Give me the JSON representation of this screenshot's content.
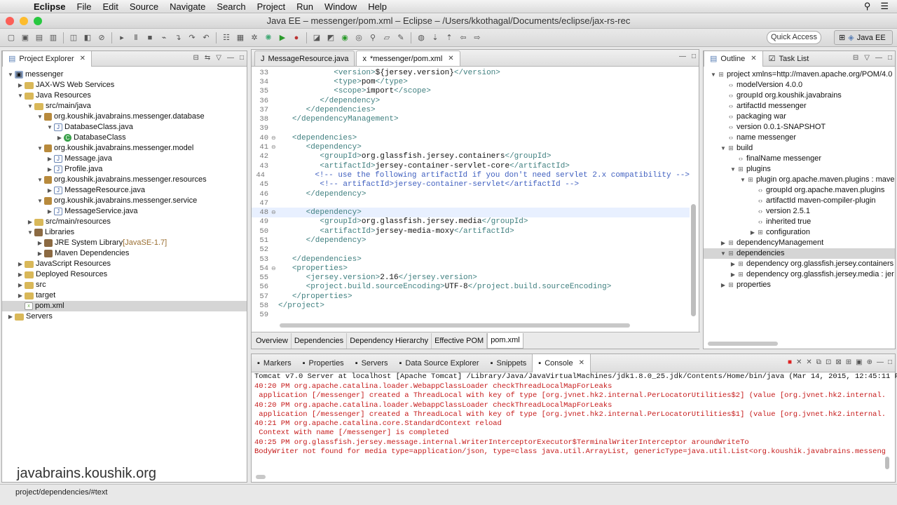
{
  "menubar": {
    "app_name": "Eclipse",
    "items": [
      "File",
      "Edit",
      "Source",
      "Navigate",
      "Search",
      "Project",
      "Run",
      "Window",
      "Help"
    ]
  },
  "window": {
    "title": "Java EE – messenger/pom.xml – Eclipse – /Users/kkothagal/Documents/eclipse/jax-rs-rec"
  },
  "toolbar": {
    "quick_access": "Quick Access",
    "perspective": "Java EE"
  },
  "project_explorer": {
    "tab_label": "Project Explorer",
    "items": [
      {
        "label": "messenger",
        "extra": "",
        "indent": 0,
        "twisty": "open",
        "icon": "proj"
      },
      {
        "label": "JAX-WS Web Services",
        "extra": "",
        "indent": 1,
        "twisty": "closed",
        "icon": "folder"
      },
      {
        "label": "Java Resources",
        "extra": "",
        "indent": 1,
        "twisty": "open",
        "icon": "folder"
      },
      {
        "label": "src/main/java",
        "extra": "",
        "indent": 2,
        "twisty": "open",
        "icon": "folder"
      },
      {
        "label": "org.koushik.javabrains.messenger.database",
        "extra": "",
        "indent": 3,
        "twisty": "open",
        "icon": "pkg"
      },
      {
        "label": "DatabaseClass.java",
        "extra": "",
        "indent": 4,
        "twisty": "open",
        "icon": "java"
      },
      {
        "label": "DatabaseClass",
        "extra": "",
        "indent": 5,
        "twisty": "closed",
        "icon": "cls"
      },
      {
        "label": "org.koushik.javabrains.messenger.model",
        "extra": "",
        "indent": 3,
        "twisty": "open",
        "icon": "pkg"
      },
      {
        "label": "Message.java",
        "extra": "",
        "indent": 4,
        "twisty": "closed",
        "icon": "java"
      },
      {
        "label": "Profile.java",
        "extra": "",
        "indent": 4,
        "twisty": "closed",
        "icon": "java"
      },
      {
        "label": "org.koushik.javabrains.messenger.resources",
        "extra": "",
        "indent": 3,
        "twisty": "open",
        "icon": "pkg"
      },
      {
        "label": "MessageResource.java",
        "extra": "",
        "indent": 4,
        "twisty": "closed",
        "icon": "java"
      },
      {
        "label": "org.koushik.javabrains.messenger.service",
        "extra": "",
        "indent": 3,
        "twisty": "open",
        "icon": "pkg"
      },
      {
        "label": "MessageService.java",
        "extra": "",
        "indent": 4,
        "twisty": "closed",
        "icon": "java"
      },
      {
        "label": "src/main/resources",
        "extra": "",
        "indent": 2,
        "twisty": "closed",
        "icon": "folder"
      },
      {
        "label": "Libraries",
        "extra": "",
        "indent": 2,
        "twisty": "open",
        "icon": "lib"
      },
      {
        "label": "JRE System Library",
        "extra": "[JavaSE-1.7]",
        "indent": 3,
        "twisty": "closed",
        "icon": "lib"
      },
      {
        "label": "Maven Dependencies",
        "extra": "",
        "indent": 3,
        "twisty": "closed",
        "icon": "lib"
      },
      {
        "label": "JavaScript Resources",
        "extra": "",
        "indent": 1,
        "twisty": "closed",
        "icon": "folder"
      },
      {
        "label": "Deployed Resources",
        "extra": "",
        "indent": 1,
        "twisty": "closed",
        "icon": "folder"
      },
      {
        "label": "src",
        "extra": "",
        "indent": 1,
        "twisty": "closed",
        "icon": "folder"
      },
      {
        "label": "target",
        "extra": "",
        "indent": 1,
        "twisty": "closed",
        "icon": "folder"
      },
      {
        "label": "pom.xml",
        "extra": "",
        "indent": 1,
        "twisty": "none",
        "icon": "xml",
        "selected": true
      },
      {
        "label": "Servers",
        "extra": "",
        "indent": 0,
        "twisty": "closed",
        "icon": "folder"
      }
    ]
  },
  "editor": {
    "tabs": [
      {
        "label": "MessageResource.java",
        "active": false
      },
      {
        "label": "*messenger/pom.xml",
        "active": true
      }
    ],
    "lines": [
      {
        "n": "33",
        "text": "            <version>${jersey.version}</version>",
        "fold": ""
      },
      {
        "n": "34",
        "text": "            <type>pom</type>",
        "fold": ""
      },
      {
        "n": "35",
        "text": "            <scope>import</scope>",
        "fold": ""
      },
      {
        "n": "36",
        "text": "         </dependency>",
        "fold": ""
      },
      {
        "n": "37",
        "text": "      </dependencies>",
        "fold": ""
      },
      {
        "n": "38",
        "text": "   </dependencyManagement>",
        "fold": ""
      },
      {
        "n": "39",
        "text": "",
        "fold": ""
      },
      {
        "n": "40",
        "text": "   <dependencies>",
        "fold": "⊖"
      },
      {
        "n": "41",
        "text": "      <dependency>",
        "fold": "⊖"
      },
      {
        "n": "42",
        "text": "         <groupId>org.glassfish.jersey.containers</groupId>",
        "fold": ""
      },
      {
        "n": "43",
        "text": "         <artifactId>jersey-container-servlet-core</artifactId>",
        "fold": ""
      },
      {
        "n": "44",
        "text": "         <!-- use the following artifactId if you don't need servlet 2.x compatibility -->",
        "fold": ""
      },
      {
        "n": "45",
        "text": "         <!-- artifactId>jersey-container-servlet</artifactId -->",
        "fold": ""
      },
      {
        "n": "46",
        "text": "      </dependency>",
        "fold": ""
      },
      {
        "n": "47",
        "text": "",
        "fold": ""
      },
      {
        "n": "48",
        "text": "      <dependency>",
        "fold": "⊖",
        "current": true
      },
      {
        "n": "49",
        "text": "         <groupId>org.glassfish.jersey.media</groupId>",
        "fold": ""
      },
      {
        "n": "50",
        "text": "         <artifactId>jersey-media-moxy</artifactId>",
        "fold": ""
      },
      {
        "n": "51",
        "text": "      </dependency>",
        "fold": ""
      },
      {
        "n": "52",
        "text": "",
        "fold": ""
      },
      {
        "n": "53",
        "text": "   </dependencies>",
        "fold": ""
      },
      {
        "n": "54",
        "text": "   <properties>",
        "fold": "⊖"
      },
      {
        "n": "55",
        "text": "      <jersey.version>2.16</jersey.version>",
        "fold": ""
      },
      {
        "n": "56",
        "text": "      <project.build.sourceEncoding>UTF-8</project.build.sourceEncoding>",
        "fold": ""
      },
      {
        "n": "57",
        "text": "   </properties>",
        "fold": ""
      },
      {
        "n": "58",
        "text": "</project>",
        "fold": ""
      },
      {
        "n": "59",
        "text": "",
        "fold": ""
      }
    ],
    "bottom_tabs": [
      {
        "label": "Overview",
        "active": false
      },
      {
        "label": "Dependencies",
        "active": false
      },
      {
        "label": "Dependency Hierarchy",
        "active": false
      },
      {
        "label": "Effective POM",
        "active": false
      },
      {
        "label": "pom.xml",
        "active": true
      }
    ]
  },
  "outline": {
    "tabs": [
      "Outline",
      "Task List"
    ],
    "items": [
      {
        "label": "project xmlns=http://maven.apache.org/POM/4.0",
        "indent": 0,
        "twisty": "open"
      },
      {
        "label": "modelVersion  4.0.0",
        "indent": 1,
        "twisty": "none"
      },
      {
        "label": "groupId  org.koushik.javabrains",
        "indent": 1,
        "twisty": "none"
      },
      {
        "label": "artifactId  messenger",
        "indent": 1,
        "twisty": "none"
      },
      {
        "label": "packaging  war",
        "indent": 1,
        "twisty": "none"
      },
      {
        "label": "version  0.0.1-SNAPSHOT",
        "indent": 1,
        "twisty": "none"
      },
      {
        "label": "name  messenger",
        "indent": 1,
        "twisty": "none"
      },
      {
        "label": "build",
        "indent": 1,
        "twisty": "open"
      },
      {
        "label": "finalName  messenger",
        "indent": 2,
        "twisty": "none"
      },
      {
        "label": "plugins",
        "indent": 2,
        "twisty": "open"
      },
      {
        "label": "plugin  org.apache.maven.plugins : mave",
        "indent": 3,
        "twisty": "open"
      },
      {
        "label": "groupId  org.apache.maven.plugins",
        "indent": 4,
        "twisty": "none"
      },
      {
        "label": "artifactId  maven-compiler-plugin",
        "indent": 4,
        "twisty": "none"
      },
      {
        "label": "version  2.5.1",
        "indent": 4,
        "twisty": "none"
      },
      {
        "label": "inherited  true",
        "indent": 4,
        "twisty": "none"
      },
      {
        "label": "configuration",
        "indent": 4,
        "twisty": "closed"
      },
      {
        "label": "dependencyManagement",
        "indent": 1,
        "twisty": "closed"
      },
      {
        "label": "dependencies",
        "indent": 1,
        "twisty": "open",
        "selected": true
      },
      {
        "label": "dependency  org.glassfish.jersey.containers",
        "indent": 2,
        "twisty": "closed"
      },
      {
        "label": "dependency  org.glassfish.jersey.media : jer",
        "indent": 2,
        "twisty": "closed"
      },
      {
        "label": "properties",
        "indent": 1,
        "twisty": "closed"
      }
    ]
  },
  "console": {
    "tabs": [
      {
        "label": "Markers",
        "active": false
      },
      {
        "label": "Properties",
        "active": false
      },
      {
        "label": "Servers",
        "active": false
      },
      {
        "label": "Data Source Explorer",
        "active": false
      },
      {
        "label": "Snippets",
        "active": false
      },
      {
        "label": "Console",
        "active": true
      }
    ],
    "header": "Tomcat v7.0 Server at localhost [Apache Tomcat] /Library/Java/JavaVirtualMachines/jdk1.8.0_25.jdk/Contents/Home/bin/java (Mar 14, 2015, 12:45:11 PM)",
    "lines": [
      "40:20 PM org.apache.catalina.loader.WebappClassLoader checkThreadLocalMapForLeaks",
      " application [/messenger] created a ThreadLocal with key of type [org.jvnet.hk2.internal.PerLocatorUtilities$2] (value [org.jvnet.hk2.internal.P",
      "40:20 PM org.apache.catalina.loader.WebappClassLoader checkThreadLocalMapForLeaks",
      " application [/messenger] created a ThreadLocal with key of type [org.jvnet.hk2.internal.PerLocatorUtilities$1] (value [org.jvnet.hk2.internal.P",
      "40:21 PM org.apache.catalina.core.StandardContext reload",
      " Context with name [/messenger] is completed",
      "40:25 PM org.glassfish.jersey.message.internal.WriterInterceptorExecutor$TerminalWriterInterceptor aroundWriteTo",
      "BodyWriter not found for media type=application/json, type=class java.util.ArrayList, genericType=java.util.List<org.koushik.javabrains.messenge"
    ]
  },
  "statusbar": {
    "path": "project/dependencies/#text"
  },
  "watermark": "javabrains.koushik.org"
}
